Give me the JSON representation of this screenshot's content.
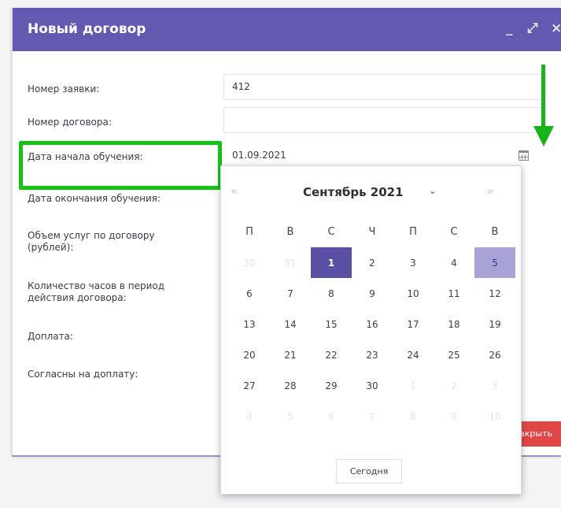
{
  "dialog": {
    "title": "Новый договор",
    "controls": {
      "minimize": "_",
      "maximize": "⤢",
      "close": "×"
    },
    "close_button": "Закрыть"
  },
  "form": {
    "application_number_label": "Номер заявки:",
    "application_number_value": "412",
    "contract_number_label": "Номер договора:",
    "contract_number_value": "",
    "start_date_label": "Дата начала обучения:",
    "start_date_value": "01.09.2021",
    "end_date_label": "Дата окончания обучения:",
    "amount_label": "Объем услуг по договору (рублей):",
    "hours_label": "Количество часов в период действия договора:",
    "surcharge_label": "Доплата:",
    "agree_surcharge_label": "Согласны на доплату:"
  },
  "datepicker": {
    "prev": "«",
    "next": "»",
    "month": "Сентябрь 2021",
    "caret": "⌄",
    "weekdays": [
      "П",
      "В",
      "С",
      "Ч",
      "П",
      "С",
      "В"
    ],
    "weeks": [
      [
        "30",
        "31",
        "1",
        "2",
        "3",
        "4",
        "5"
      ],
      [
        "6",
        "7",
        "8",
        "9",
        "10",
        "11",
        "12"
      ],
      [
        "13",
        "14",
        "15",
        "16",
        "17",
        "18",
        "19"
      ],
      [
        "20",
        "21",
        "22",
        "23",
        "24",
        "25",
        "26"
      ],
      [
        "27",
        "28",
        "29",
        "30",
        "1",
        "2",
        "3"
      ],
      [
        "4",
        "5",
        "6",
        "7",
        "8",
        "9",
        "10"
      ]
    ],
    "today_button": "Сегодня"
  },
  "colors": {
    "header": "#6459b0",
    "today": "#5a4fa5",
    "selected": "#a9a2d6",
    "annotation": "#14c414",
    "close": "#e04646"
  },
  "icons": {
    "calendar": "calendar-icon",
    "annotation_arrow": "green-arrow-icon"
  }
}
